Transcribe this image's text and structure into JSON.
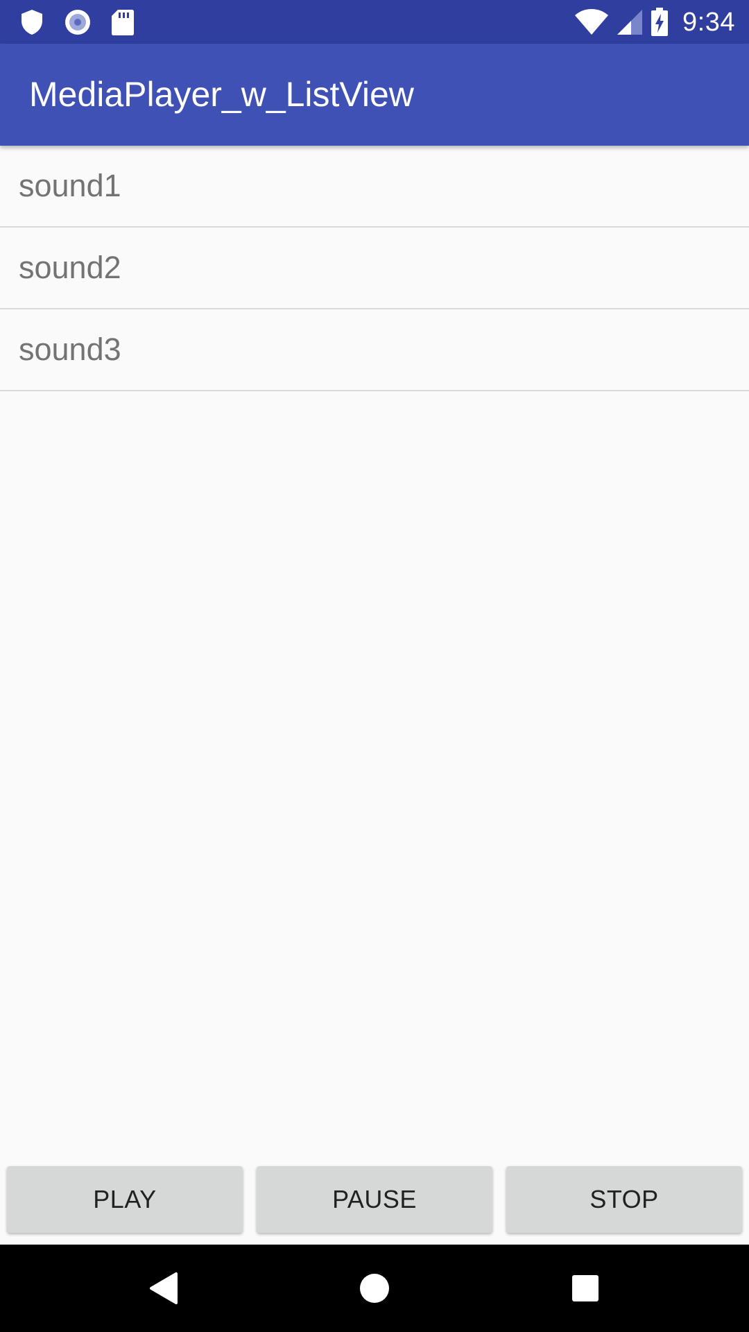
{
  "status_bar": {
    "time": "9:34",
    "left_icons": [
      "shield-icon",
      "record-icon",
      "sd-card-icon"
    ],
    "right_icons": [
      "wifi-icon",
      "cell-signal-icon",
      "battery-charging-icon"
    ]
  },
  "app_bar": {
    "title": "MediaPlayer_w_ListView"
  },
  "list": {
    "items": [
      {
        "label": "sound1"
      },
      {
        "label": "sound2"
      },
      {
        "label": "sound3"
      }
    ]
  },
  "buttons": {
    "play_label": "PLAY",
    "pause_label": "PAUSE",
    "stop_label": "STOP"
  },
  "nav_bar": {
    "icons": [
      "back-icon",
      "home-icon",
      "recents-icon"
    ]
  },
  "colors": {
    "status_bar": "#303f9f",
    "app_bar": "#3f51b5",
    "background": "#fafafa",
    "button": "#d6d7d7",
    "list_text": "#737373"
  }
}
